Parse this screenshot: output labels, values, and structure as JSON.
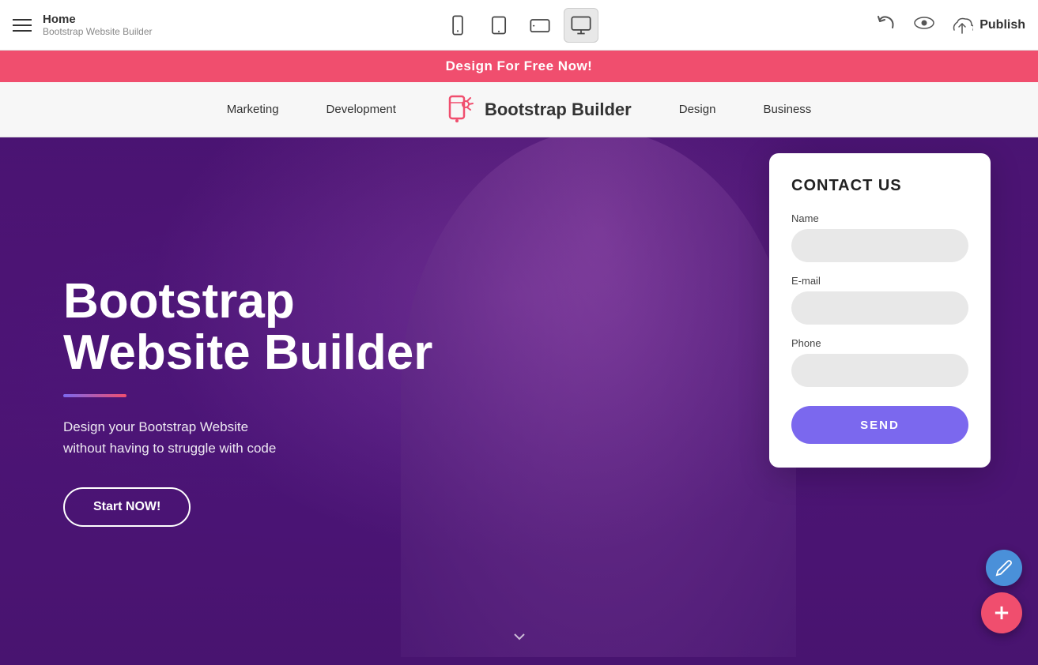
{
  "toolbar": {
    "home_label": "Home",
    "subtitle": "Bootstrap Website Builder",
    "publish_label": "Publish"
  },
  "promo": {
    "text": "Design For Free Now!"
  },
  "site_navbar": {
    "links": [
      "Marketing",
      "Development",
      "Design",
      "Business"
    ],
    "logo_text": "Bootstrap Builder"
  },
  "hero": {
    "title_line1": "Bootstrap",
    "title_line2": "Website Builder",
    "subtitle": "Design your Bootstrap Website\nwithout having to struggle with code",
    "cta_label": "Start NOW!"
  },
  "contact": {
    "title": "CONTACT US",
    "name_label": "Name",
    "name_placeholder": "",
    "email_label": "E-mail",
    "email_placeholder": "",
    "phone_label": "Phone",
    "phone_placeholder": "",
    "send_label": "SEND"
  },
  "devices": {
    "mobile_label": "mobile-device",
    "tablet_label": "tablet-device",
    "tablet_landscape_label": "tablet-landscape-device",
    "desktop_label": "desktop-device"
  }
}
